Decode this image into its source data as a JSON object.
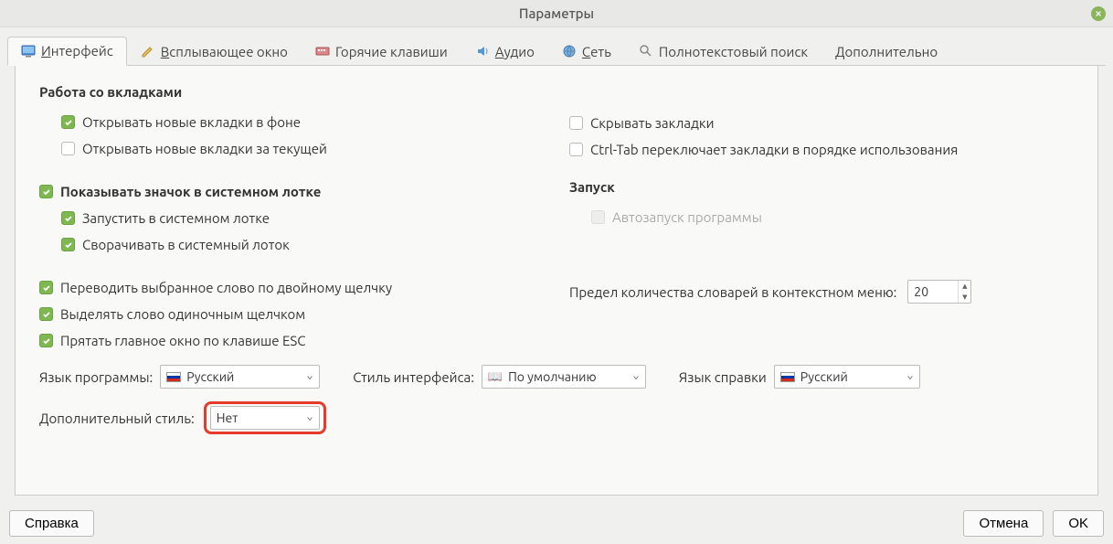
{
  "window": {
    "title": "Параметры"
  },
  "tabs": {
    "interface": "Интерфейс",
    "popup": "Всплывающее окно",
    "hotkeys": "Горячие клавиши",
    "audio": "Аудио",
    "network": "Сеть",
    "fulltext": "Полнотекстовый поиск",
    "advanced": "Дополнительно"
  },
  "sections": {
    "tabs_work": "Работа со вкладками",
    "launch": "Запуск"
  },
  "checks": {
    "open_bg": "Открывать новые вкладки в фоне",
    "open_after_current": "Открывать новые вкладки за текущей",
    "hide_bookmarks": "Скрывать закладки",
    "ctrl_tab": "Ctrl-Tab переключает закладки в порядке использования",
    "show_tray": "Показывать значок в системном лотке",
    "start_tray": "Запустить в системном лотке",
    "minimize_tray": "Сворачивать в системный лоток",
    "autostart": "Автозапуск программы",
    "dbl_translate": "Переводить выбранное слово по двойному щелчку",
    "single_select": "Выделять слово одиночным щелчком",
    "hide_esc": "Прятать главное окно по клавише ESC",
    "dict_limit_label": "Предел количества словарей в контекстном меню:"
  },
  "values": {
    "dict_limit": "20"
  },
  "combos": {
    "prog_lang_label": "Язык программы:",
    "prog_lang_value": "Русский",
    "style_label": "Стиль интерфейса:",
    "style_value": "По умолчанию",
    "help_lang_label": "Язык справки",
    "help_lang_value": "Русский",
    "addon_style_label": "Дополнительный стиль:",
    "addon_style_value": "Нет"
  },
  "buttons": {
    "help": "Справка",
    "cancel": "Отмена",
    "ok": "OK"
  }
}
